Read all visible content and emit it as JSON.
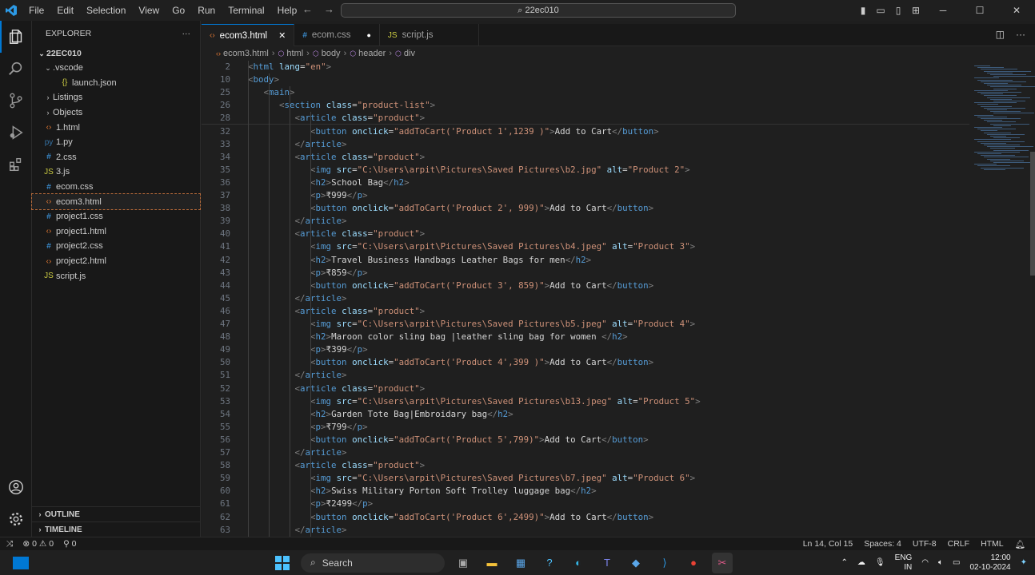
{
  "titlebar": {
    "menu": [
      "File",
      "Edit",
      "Selection",
      "View",
      "Go",
      "Run",
      "Terminal",
      "Help"
    ],
    "search": "22ec010"
  },
  "sidebar": {
    "title": "EXPLORER",
    "root": "22EC010",
    "items": [
      {
        "label": ".vscode",
        "type": "folder-open",
        "indent": 1,
        "icon": "chevron-down"
      },
      {
        "label": "launch.json",
        "type": "json",
        "indent": 2,
        "icon": "{}"
      },
      {
        "label": "Listings",
        "type": "folder",
        "indent": 1,
        "icon": "chevron-right"
      },
      {
        "label": "Objects",
        "type": "folder",
        "indent": 1,
        "icon": "chevron-right"
      },
      {
        "label": "1.html",
        "type": "html",
        "indent": 1,
        "icon": "<>"
      },
      {
        "label": "1.py",
        "type": "py",
        "indent": 1,
        "icon": "py"
      },
      {
        "label": "2.css",
        "type": "css",
        "indent": 1,
        "icon": "#"
      },
      {
        "label": "3.js",
        "type": "js",
        "indent": 1,
        "icon": "JS"
      },
      {
        "label": "ecom.css",
        "type": "css",
        "indent": 1,
        "icon": "#"
      },
      {
        "label": "ecom3.html",
        "type": "html",
        "indent": 1,
        "icon": "<>",
        "selected": true
      },
      {
        "label": "project1.css",
        "type": "css",
        "indent": 1,
        "icon": "#"
      },
      {
        "label": "project1.html",
        "type": "html",
        "indent": 1,
        "icon": "<>"
      },
      {
        "label": "project2.css",
        "type": "css",
        "indent": 1,
        "icon": "#"
      },
      {
        "label": "project2.html",
        "type": "html",
        "indent": 1,
        "icon": "<>"
      },
      {
        "label": "script.js",
        "type": "js",
        "indent": 1,
        "icon": "JS"
      }
    ],
    "outline": "OUTLINE",
    "timeline": "TIMELINE"
  },
  "tabs": [
    {
      "label": "ecom3.html",
      "icon": "<>",
      "active": true
    },
    {
      "label": "ecom.css",
      "icon": "#",
      "dirty": true
    },
    {
      "label": "script.js",
      "icon": "JS"
    }
  ],
  "breadcrumb": [
    "ecom3.html",
    "html",
    "body",
    "header",
    "div"
  ],
  "code": [
    {
      "n": "2",
      "c": "<html lang=\"en\">"
    },
    {
      "n": "10",
      "c": "<body>"
    },
    {
      "n": "25",
      "c": "  <main>"
    },
    {
      "n": "26",
      "c": "    <section class=\"product-list\">"
    },
    {
      "n": "28",
      "c": "      <article class=\"product\">"
    },
    {
      "n": "32",
      "c": "        <button onclick=\"addToCart('Product 1',1239 )\">Add to Cart</button>"
    },
    {
      "n": "33",
      "c": "      </article>"
    },
    {
      "n": "34",
      "c": "      <article class=\"product\">"
    },
    {
      "n": "35",
      "c": "        <img src=\"C:\\Users\\arpit\\Pictures\\Saved Pictures\\b2.jpg\" alt=\"Product 2\">"
    },
    {
      "n": "36",
      "c": "        <h2>School Bag</h2>"
    },
    {
      "n": "37",
      "c": "        <p>₹999</p>"
    },
    {
      "n": "38",
      "c": "        <button onclick=\"addToCart('Product 2', 999)\">Add to Cart</button>"
    },
    {
      "n": "39",
      "c": "      </article>"
    },
    {
      "n": "40",
      "c": "      <article class=\"product\">"
    },
    {
      "n": "41",
      "c": "        <img src=\"C:\\Users\\arpit\\Pictures\\Saved Pictures\\b4.jpeg\" alt=\"Product 3\">"
    },
    {
      "n": "42",
      "c": "        <h2>Travel Business Handbags Leather Bags for men</h2>"
    },
    {
      "n": "43",
      "c": "        <p>₹859</p>"
    },
    {
      "n": "44",
      "c": "        <button onclick=\"addToCart('Product 3', 859)\">Add to Cart</button>"
    },
    {
      "n": "45",
      "c": "      </article>"
    },
    {
      "n": "46",
      "c": "      <article class=\"product\">"
    },
    {
      "n": "47",
      "c": "        <img src=\"C:\\Users\\arpit\\Pictures\\Saved Pictures\\b5.jpeg\" alt=\"Product 4\">"
    },
    {
      "n": "48",
      "c": "        <h2>Maroon color sling bag |leather sling bag for women </h2>"
    },
    {
      "n": "49",
      "c": "        <p>₹399</p>"
    },
    {
      "n": "50",
      "c": "        <button onclick=\"addToCart('Product 4',399 )\">Add to Cart</button>"
    },
    {
      "n": "51",
      "c": "      </article>"
    },
    {
      "n": "52",
      "c": "      <article class=\"product\">"
    },
    {
      "n": "53",
      "c": "        <img src=\"C:\\Users\\arpit\\Pictures\\Saved Pictures\\b13.jpeg\" alt=\"Product 5\">"
    },
    {
      "n": "54",
      "c": "        <h2>Garden Tote Bag|Embroidary bag</h2>"
    },
    {
      "n": "55",
      "c": "        <p>₹799</p>"
    },
    {
      "n": "56",
      "c": "        <button onclick=\"addToCart('Product 5',799)\">Add to Cart</button>"
    },
    {
      "n": "57",
      "c": "      </article>"
    },
    {
      "n": "58",
      "c": "      <article class=\"product\">"
    },
    {
      "n": "59",
      "c": "        <img src=\"C:\\Users\\arpit\\Pictures\\Saved Pictures\\b7.jpeg\" alt=\"Product 6\">"
    },
    {
      "n": "60",
      "c": "        <h2>Swiss Military Porton Soft Trolley luggage bag</h2>"
    },
    {
      "n": "61",
      "c": "        <p>₹2499</p>"
    },
    {
      "n": "62",
      "c": "        <button onclick=\"addToCart('Product 6',2499)\">Add to Cart</button>"
    },
    {
      "n": "63",
      "c": "      </article>"
    }
  ],
  "status": {
    "errors": "0",
    "warnings": "0",
    "ports": "0",
    "position": "Ln 14, Col 15",
    "spaces": "Spaces: 4",
    "encoding": "UTF-8",
    "eol": "CRLF",
    "language": "HTML"
  },
  "taskbar": {
    "search": "Search",
    "lang": "ENG",
    "region": "IN",
    "time": "12:00",
    "date": "02-10-2024"
  },
  "colors": {
    "accent": "#0078d4",
    "tag": "#569cd6",
    "attr": "#9cdcfe",
    "string": "#ce9178"
  }
}
